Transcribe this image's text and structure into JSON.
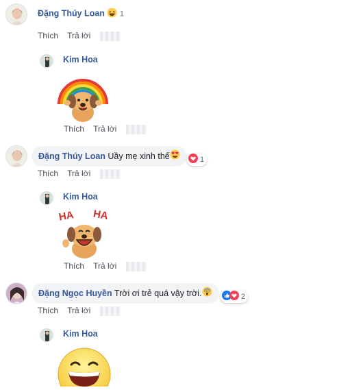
{
  "actions": {
    "like": "Thích",
    "reply": "Trả lời"
  },
  "comments": [
    {
      "author": "Đặng Thúy Loan",
      "text": "",
      "reaction_count": "1",
      "reply": {
        "author": "Kim Hoa",
        "sticker": "rainbow-puppy-sticker"
      }
    },
    {
      "author": "Đặng Thúy Loan",
      "text": "Uầy mẹ xinh thế",
      "reaction_count": "1",
      "reply": {
        "author": "Kim Hoa",
        "sticker": "haha-puppy-sticker",
        "sticker_text": [
          "HA",
          "HA"
        ]
      }
    },
    {
      "author": "Đặng Ngọc Huyền",
      "text": "Trời ơi trẻ quá vậy trời.",
      "reaction_count": "2",
      "reply": {
        "author": "Kim Hoa",
        "sticker": "laughing-face-sticker"
      }
    }
  ],
  "colors": {
    "name": "#365899",
    "bubble": "#f2f3f5",
    "action": "#4b4f56",
    "love": "#f33e58",
    "like": "#1877f2"
  }
}
